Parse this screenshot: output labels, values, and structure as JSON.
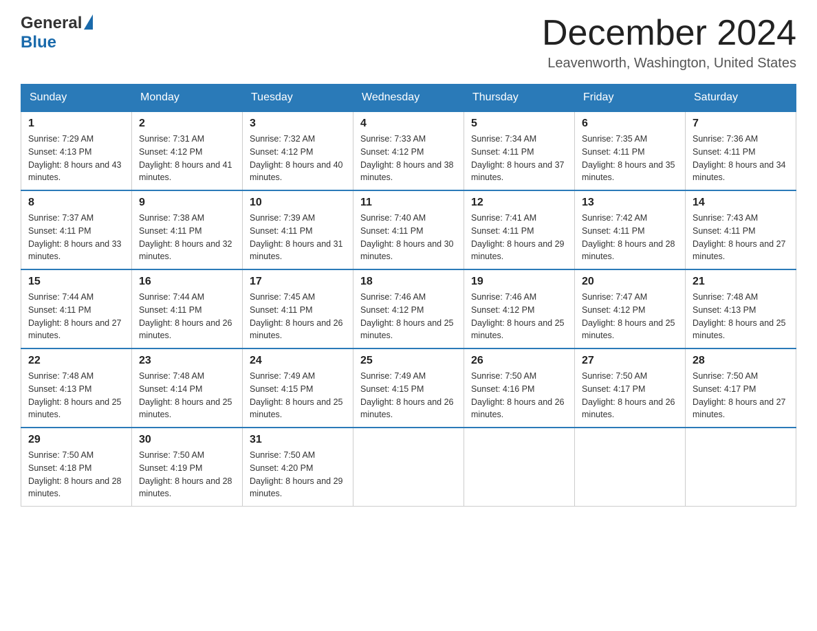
{
  "header": {
    "logo_general": "General",
    "logo_blue": "Blue",
    "month_title": "December 2024",
    "location": "Leavenworth, Washington, United States"
  },
  "days_of_week": [
    "Sunday",
    "Monday",
    "Tuesday",
    "Wednesday",
    "Thursday",
    "Friday",
    "Saturday"
  ],
  "weeks": [
    [
      {
        "day": "1",
        "sunrise": "7:29 AM",
        "sunset": "4:13 PM",
        "daylight": "8 hours and 43 minutes."
      },
      {
        "day": "2",
        "sunrise": "7:31 AM",
        "sunset": "4:12 PM",
        "daylight": "8 hours and 41 minutes."
      },
      {
        "day": "3",
        "sunrise": "7:32 AM",
        "sunset": "4:12 PM",
        "daylight": "8 hours and 40 minutes."
      },
      {
        "day": "4",
        "sunrise": "7:33 AM",
        "sunset": "4:12 PM",
        "daylight": "8 hours and 38 minutes."
      },
      {
        "day": "5",
        "sunrise": "7:34 AM",
        "sunset": "4:11 PM",
        "daylight": "8 hours and 37 minutes."
      },
      {
        "day": "6",
        "sunrise": "7:35 AM",
        "sunset": "4:11 PM",
        "daylight": "8 hours and 35 minutes."
      },
      {
        "day": "7",
        "sunrise": "7:36 AM",
        "sunset": "4:11 PM",
        "daylight": "8 hours and 34 minutes."
      }
    ],
    [
      {
        "day": "8",
        "sunrise": "7:37 AM",
        "sunset": "4:11 PM",
        "daylight": "8 hours and 33 minutes."
      },
      {
        "day": "9",
        "sunrise": "7:38 AM",
        "sunset": "4:11 PM",
        "daylight": "8 hours and 32 minutes."
      },
      {
        "day": "10",
        "sunrise": "7:39 AM",
        "sunset": "4:11 PM",
        "daylight": "8 hours and 31 minutes."
      },
      {
        "day": "11",
        "sunrise": "7:40 AM",
        "sunset": "4:11 PM",
        "daylight": "8 hours and 30 minutes."
      },
      {
        "day": "12",
        "sunrise": "7:41 AM",
        "sunset": "4:11 PM",
        "daylight": "8 hours and 29 minutes."
      },
      {
        "day": "13",
        "sunrise": "7:42 AM",
        "sunset": "4:11 PM",
        "daylight": "8 hours and 28 minutes."
      },
      {
        "day": "14",
        "sunrise": "7:43 AM",
        "sunset": "4:11 PM",
        "daylight": "8 hours and 27 minutes."
      }
    ],
    [
      {
        "day": "15",
        "sunrise": "7:44 AM",
        "sunset": "4:11 PM",
        "daylight": "8 hours and 27 minutes."
      },
      {
        "day": "16",
        "sunrise": "7:44 AM",
        "sunset": "4:11 PM",
        "daylight": "8 hours and 26 minutes."
      },
      {
        "day": "17",
        "sunrise": "7:45 AM",
        "sunset": "4:11 PM",
        "daylight": "8 hours and 26 minutes."
      },
      {
        "day": "18",
        "sunrise": "7:46 AM",
        "sunset": "4:12 PM",
        "daylight": "8 hours and 25 minutes."
      },
      {
        "day": "19",
        "sunrise": "7:46 AM",
        "sunset": "4:12 PM",
        "daylight": "8 hours and 25 minutes."
      },
      {
        "day": "20",
        "sunrise": "7:47 AM",
        "sunset": "4:12 PM",
        "daylight": "8 hours and 25 minutes."
      },
      {
        "day": "21",
        "sunrise": "7:48 AM",
        "sunset": "4:13 PM",
        "daylight": "8 hours and 25 minutes."
      }
    ],
    [
      {
        "day": "22",
        "sunrise": "7:48 AM",
        "sunset": "4:13 PM",
        "daylight": "8 hours and 25 minutes."
      },
      {
        "day": "23",
        "sunrise": "7:48 AM",
        "sunset": "4:14 PM",
        "daylight": "8 hours and 25 minutes."
      },
      {
        "day": "24",
        "sunrise": "7:49 AM",
        "sunset": "4:15 PM",
        "daylight": "8 hours and 25 minutes."
      },
      {
        "day": "25",
        "sunrise": "7:49 AM",
        "sunset": "4:15 PM",
        "daylight": "8 hours and 26 minutes."
      },
      {
        "day": "26",
        "sunrise": "7:50 AM",
        "sunset": "4:16 PM",
        "daylight": "8 hours and 26 minutes."
      },
      {
        "day": "27",
        "sunrise": "7:50 AM",
        "sunset": "4:17 PM",
        "daylight": "8 hours and 26 minutes."
      },
      {
        "day": "28",
        "sunrise": "7:50 AM",
        "sunset": "4:17 PM",
        "daylight": "8 hours and 27 minutes."
      }
    ],
    [
      {
        "day": "29",
        "sunrise": "7:50 AM",
        "sunset": "4:18 PM",
        "daylight": "8 hours and 28 minutes."
      },
      {
        "day": "30",
        "sunrise": "7:50 AM",
        "sunset": "4:19 PM",
        "daylight": "8 hours and 28 minutes."
      },
      {
        "day": "31",
        "sunrise": "7:50 AM",
        "sunset": "4:20 PM",
        "daylight": "8 hours and 29 minutes."
      },
      null,
      null,
      null,
      null
    ]
  ],
  "labels": {
    "sunrise": "Sunrise:",
    "sunset": "Sunset:",
    "daylight": "Daylight:"
  }
}
